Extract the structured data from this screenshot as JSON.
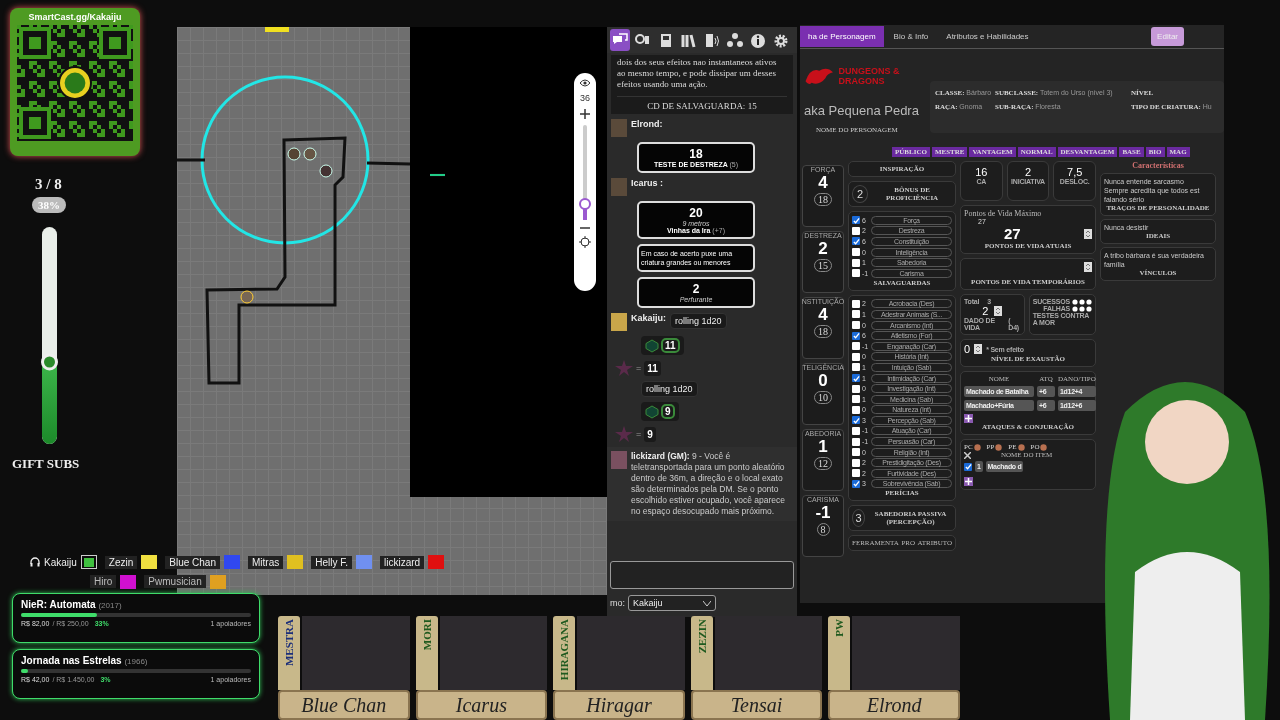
{
  "qr_card": {
    "title": "SmartCast.gg/Kakaiju"
  },
  "gift_subs": {
    "count": "3 / 8",
    "percent": "38%",
    "level": 0.38,
    "label": "GIFT SUBS"
  },
  "map": {
    "zoom": {
      "reading": "36",
      "level": 0.17
    }
  },
  "chat": {
    "tabs": [
      {
        "kind": "chat",
        "selected": true
      },
      {
        "kind": "character",
        "selected": false
      },
      {
        "kind": "journal",
        "selected": false
      },
      {
        "kind": "library",
        "selected": false
      },
      {
        "kind": "audio",
        "selected": false
      },
      {
        "kind": "nodes",
        "selected": false
      },
      {
        "kind": "info",
        "selected": false
      },
      {
        "kind": "settings",
        "selected": false
      }
    ],
    "messages": [
      {
        "kind": "spell",
        "text": "dois dos seus efeitos nao instantaneos ativos ao mesmo tempo, e pode dissipar um desses efeitos usando uma ação.",
        "save": "CD DE SALVAGUARDA: 15"
      },
      {
        "kind": "roll",
        "author": "Elrond:",
        "value": "18",
        "label": "TESTE DE DESTREZA",
        "mod": "(5)"
      },
      {
        "kind": "attack",
        "author": "Icarus :",
        "value": "20",
        "range": "9 metros",
        "label": "Vinhas da Ira",
        "mod": "(+7)",
        "description": "Em caso de acerto puxe uma criatura grandes ou menores",
        "damage": "2",
        "damage_type": "Perfurante"
      },
      {
        "kind": "command",
        "author": "Kakaiju:",
        "text": "rolling 1d20"
      },
      {
        "kind": "dice",
        "value": "11"
      },
      {
        "kind": "total",
        "sign": "=",
        "value": "11"
      },
      {
        "kind": "command",
        "text": "rolling 1d20"
      },
      {
        "kind": "dice",
        "value": "9"
      },
      {
        "kind": "total",
        "sign": "=",
        "value": "9"
      },
      {
        "kind": "gm",
        "author": "lickizard (GM):",
        "text": "9 - Você é teletransportada para um ponto aleatório dentro de 36m, a direção e o local exato são determinados pela DM. Se o ponto escolhido estiver ocupado, você aparece no espaço desocupado mais próximo."
      }
    ],
    "speaker_label": "mo:",
    "speaker": "Kakaiju"
  },
  "sheet": {
    "tabs": [
      {
        "label": "ha de Personagem",
        "selected": true
      },
      {
        "label": "Bio & Info",
        "selected": false
      },
      {
        "label": "Atributos e Habilidades",
        "selected": false
      }
    ],
    "edit_button": "Editar",
    "logo": "DUNGEONS & DRAGONS",
    "name": "aka Pequena Pedra",
    "name_caption": "NOME DO PERSONAGEM",
    "info": [
      {
        "label": "CLASSE:",
        "value": "Bárbaro"
      },
      {
        "label": "SUBCLASSE:",
        "value": "Totem do Urso (nível 3)"
      },
      {
        "label": "NÍVEL"
      },
      {
        "label": "RAÇA:",
        "value": "Gnoma"
      },
      {
        "label": "SUB-RAÇA:",
        "value": "Floresta"
      },
      {
        "label": "TIPO DE CRIATURA:",
        "value": "Hu"
      }
    ],
    "toggles": [
      "PÚBLICO",
      "MESTRE",
      "VANTAGEM",
      "NORMAL",
      "DESVANTAGEM",
      "BASE",
      "BIO",
      "MAG"
    ],
    "abilities": [
      {
        "name": "FORÇA",
        "mod": "4",
        "score": "18"
      },
      {
        "name": "DESTREZA",
        "mod": "2",
        "score": "15"
      },
      {
        "name": "NSTITUIÇÃO",
        "mod": "4",
        "score": "18"
      },
      {
        "name": "TELIGÊNCIA",
        "mod": "0",
        "score": "10"
      },
      {
        "name": "ABEDORIA",
        "mod": "1",
        "score": "12"
      },
      {
        "name": "CARISMA",
        "mod": "-1",
        "score": "8"
      }
    ],
    "inspiration": "INSPIRAÇÃO",
    "proficiency": {
      "value": "2",
      "label": "BÔNUS DE PROFICIÊNCIA"
    },
    "saves": [
      {
        "checked": true,
        "value": "6",
        "name": "Força"
      },
      {
        "checked": false,
        "value": "2",
        "name": "Destreza"
      },
      {
        "checked": true,
        "value": "6",
        "name": "Constituição"
      },
      {
        "checked": false,
        "value": "0",
        "name": "Inteligência"
      },
      {
        "checked": false,
        "value": "1",
        "name": "Sabedoria"
      },
      {
        "checked": false,
        "value": "-1",
        "name": "Carisma"
      }
    ],
    "saves_title": "SALVAGUARDAS",
    "skills": [
      {
        "checked": false,
        "value": "2",
        "name": "Acrobacia (Des)"
      },
      {
        "checked": false,
        "value": "1",
        "name": "Adestrar Animais (S..."
      },
      {
        "checked": false,
        "value": "0",
        "name": "Arcanismo (Int)"
      },
      {
        "checked": true,
        "value": "6",
        "name": "Atletismo (For)"
      },
      {
        "checked": false,
        "value": "-1",
        "name": "Enganação (Car)"
      },
      {
        "checked": false,
        "value": "0",
        "name": "História (Int)"
      },
      {
        "checked": false,
        "value": "1",
        "name": "Intuição (Sab)"
      },
      {
        "checked": true,
        "value": "1",
        "name": "Intimidação (Car)"
      },
      {
        "checked": false,
        "value": "0",
        "name": "Investigação (Int)"
      },
      {
        "checked": false,
        "value": "1",
        "name": "Medicina (Sab)"
      },
      {
        "checked": false,
        "value": "0",
        "name": "Natureza (Int)"
      },
      {
        "checked": true,
        "value": "3",
        "name": "Percepção (Sab)"
      },
      {
        "checked": false,
        "value": "-1",
        "name": "Atuação (Car)"
      },
      {
        "checked": false,
        "value": "-1",
        "name": "Persuasão (Car)"
      },
      {
        "checked": false,
        "value": "0",
        "name": "Religião (Int)"
      },
      {
        "checked": false,
        "value": "2",
        "name": "Prestidigitação (Des)"
      },
      {
        "checked": false,
        "value": "2",
        "name": "Furtividade (Des)"
      },
      {
        "checked": true,
        "value": "3",
        "name": "Sobrevivência (Sab)"
      }
    ],
    "skills_title": "PERÍCIAS",
    "passive": {
      "value": "3",
      "label": "SABEDORIA PASSIVA (PERCEPÇÃO)"
    },
    "tools_columns": [
      "FERRAMENTA",
      "PRO",
      "ATRIBUTO"
    ],
    "combat": [
      {
        "value": "16",
        "label": "CA"
      },
      {
        "value": "2",
        "label": "INICIATIVA"
      },
      {
        "value": "7,5",
        "label": "DESLOC."
      }
    ],
    "hp": {
      "title": "Pontos de Vida Máximo",
      "max": "27",
      "current": "27",
      "current_label": "PONTOS DE VIDA ATUAIS",
      "temp_label": "PONTOS DE VIDA TEMPORÁRIOS"
    },
    "hit_dice": {
      "total_label": "Total",
      "total": "3",
      "value": "2",
      "label": "DADO DE VIDA",
      "die": "( D4)"
    },
    "death_saves": {
      "successes": "SUCESSOS",
      "failures": "FALHAS",
      "label": "TESTES CONTRA A MOR"
    },
    "exhaustion": {
      "value": "0",
      "note": "* Sem efeito",
      "label": "NÍVEL DE EXAUSTÃO"
    },
    "attacks": {
      "columns": [
        "NOME",
        "ATQ",
        "DANO/TIPO"
      ],
      "rows": [
        {
          "name": "Machado de Batalha",
          "bonus": "+6",
          "damage": "1d12+4"
        },
        {
          "name": "Machado+Fúria",
          "bonus": "+6",
          "damage": "1d12+6"
        }
      ],
      "title": "ATAQUES & CONJURAÇÃO"
    },
    "coins": [
      "PC",
      "PP",
      "PE",
      "PO"
    ],
    "inventory": {
      "column": "NOME DO ITEM",
      "rows": [
        {
          "checked": true,
          "qty": "1",
          "name": "Machado d"
        }
      ]
    },
    "traits": {
      "title": "Características",
      "items": [
        {
          "text": "Nunca entende sarcasmo\nSempre acredita que todos est\nfalando sério",
          "label": "TRAÇOS DE PERSONALIDADE"
        },
        {
          "text": "Nunca desistir",
          "label": "IDEAIS"
        },
        {
          "text": "A tribo bárbara é sua verdadeira família",
          "label": "VÍNCULOS"
        }
      ]
    }
  },
  "voice": [
    {
      "kind": "self",
      "name": "Kakaiju",
      "color": "#3fbf3f"
    },
    {
      "kind": "member",
      "name": "Zezin",
      "color": "#f0e040"
    },
    {
      "kind": "member",
      "name": "Blue Chan",
      "color": "#3048f0"
    },
    {
      "kind": "member",
      "name": "Mitras",
      "color": "#e0c020"
    },
    {
      "kind": "member",
      "name": "Helly F.",
      "color": "#7090f0"
    },
    {
      "kind": "member",
      "name": "lickizard",
      "color": "#e01010"
    },
    {
      "kind": "member",
      "name": "Hiro",
      "color": "#d010d0"
    },
    {
      "kind": "member",
      "name": "Pwmusician",
      "color": "#e0a020"
    }
  ],
  "goals": [
    {
      "title": "NieR: Automata",
      "year": "(2017)",
      "raised": "R$ 82,00",
      "target": "/ R$ 250,00",
      "percent": "33%",
      "level": 0.33,
      "supporters": "1 apoiadores"
    },
    {
      "title": "Jornada nas Estrelas",
      "year": "(1966)",
      "raised": "R$ 42,00",
      "target": "/ R$ 1.450,00",
      "percent": "3%",
      "level": 0.03,
      "supporters": "1 apoiadores"
    }
  ],
  "portraits": [
    {
      "player": "MESTRA",
      "color": "#1c2f7a",
      "character": "Blue Chan"
    },
    {
      "player": "MORI",
      "color": "#1f5a1f",
      "character": "Icarus"
    },
    {
      "player": "HIRAGANA",
      "color": "#1f5a1f",
      "character": "Hiragar"
    },
    {
      "player": "ZEZIN",
      "color": "#1f5a1f",
      "character": "Tensai"
    },
    {
      "player": "PW",
      "color": "#1f5a1f",
      "character": "Elrond"
    }
  ]
}
